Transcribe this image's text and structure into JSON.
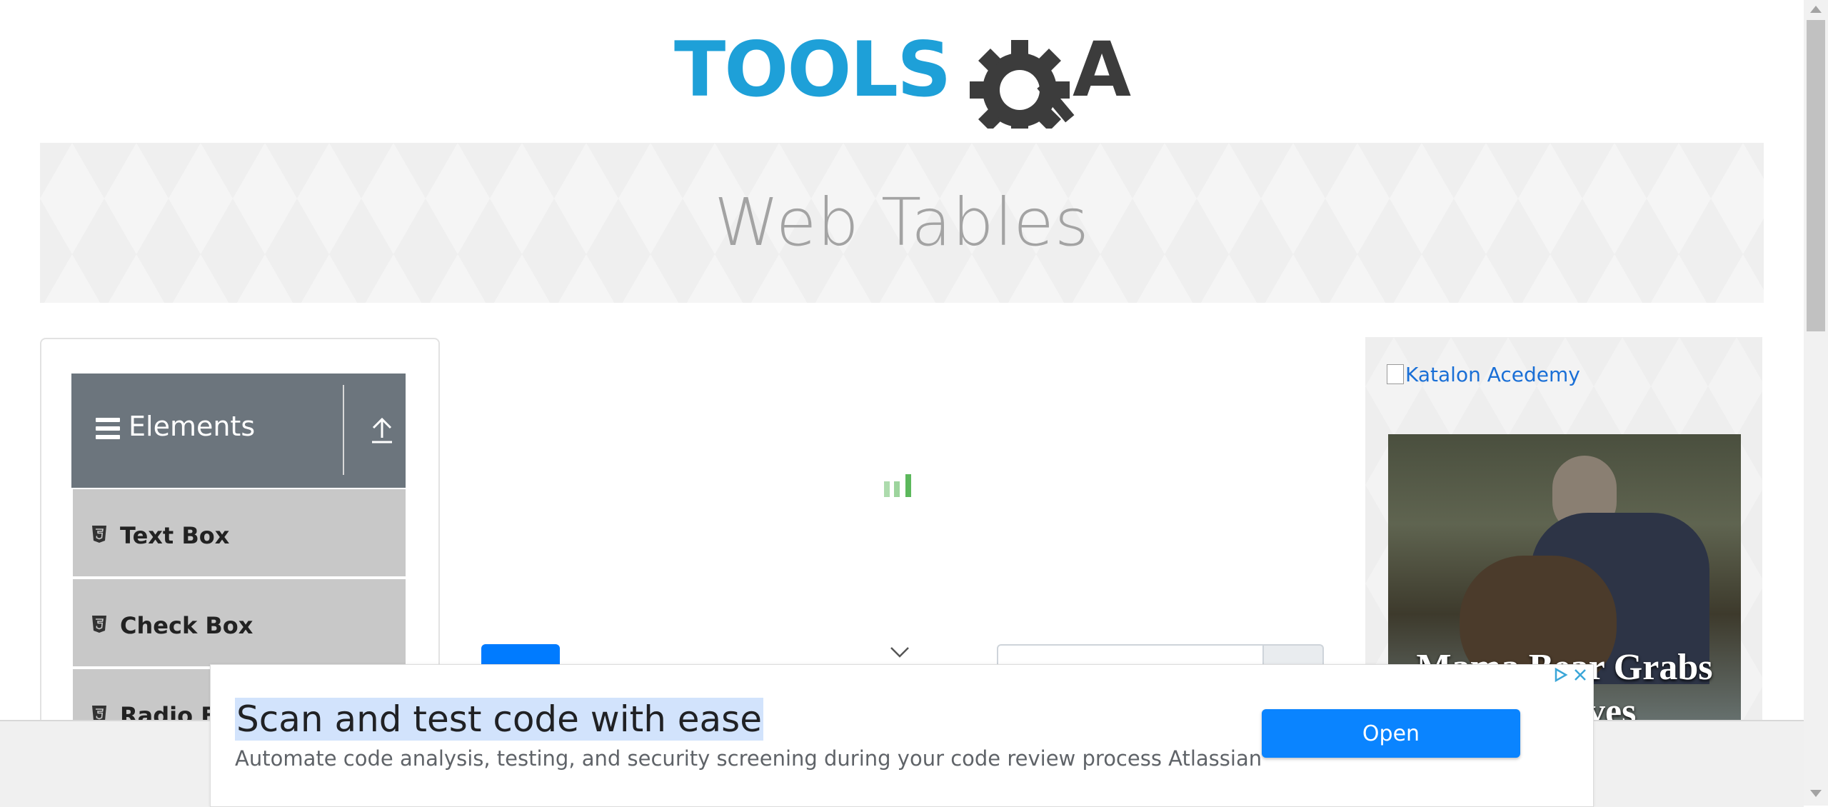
{
  "page": {
    "title": "Web Tables"
  },
  "logo": {
    "text_left": "TOOLS",
    "text_right": "A",
    "brand_blue": "#1ea0d8",
    "brand_dark": "#3c3c3c"
  },
  "sidebar": {
    "group_title": "Elements",
    "group_icon": "hamburger-icon",
    "collapse_icon": "upload-arrow-icon",
    "items": [
      {
        "label": "Text Box",
        "icon": "html5-icon"
      },
      {
        "label": "Check Box",
        "icon": "html5-icon"
      },
      {
        "label": "Radio Button",
        "icon": "html5-icon"
      }
    ]
  },
  "right_ad": {
    "link_text": "Katalon Acedemy",
    "image_caption": "Mama Bear Grabs\nHe Saves"
  },
  "bottom_ad": {
    "headline": "Scan and test code with ease",
    "body": "Automate code analysis, testing, and security screening during your code review process Atlassian",
    "cta": "Open",
    "accent": "#0a84ff"
  }
}
